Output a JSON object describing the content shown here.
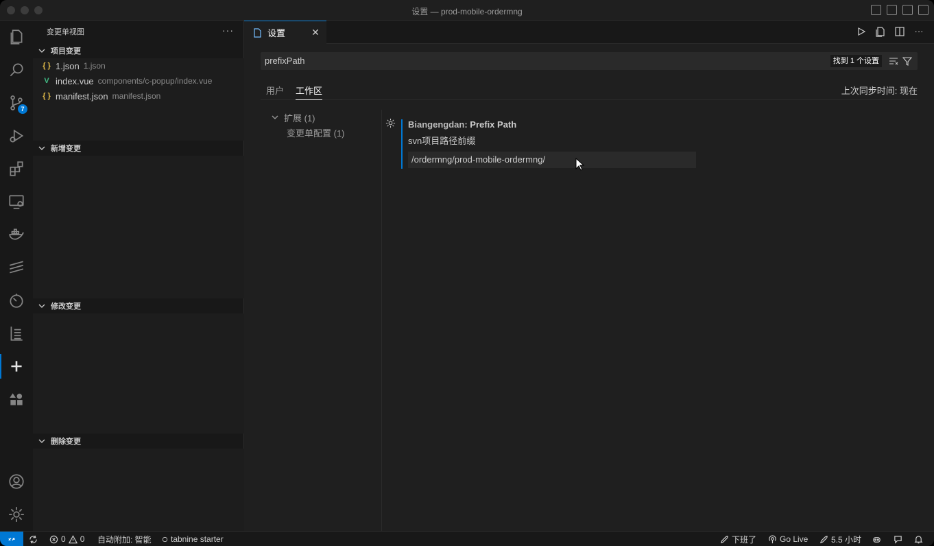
{
  "window": {
    "title": "设置 — prod-mobile-ordermng"
  },
  "activity_bar": {
    "source_control_badge": "7",
    "items": [
      "explorer-icon",
      "search-icon",
      "source-control-icon",
      "run-debug-icon",
      "extensions-icon",
      "remote-explorer-icon",
      "docker-icon",
      "svn-icon",
      "timeline-icon",
      "test-icon",
      "changelist-icon",
      "app-icon",
      "accounts-icon",
      "manage-icon"
    ]
  },
  "sidebar": {
    "title": "变更单视图",
    "more": "···",
    "sections": [
      {
        "label": "项目变更",
        "files": [
          {
            "icon": "{ }",
            "name": "1.json",
            "desc": "1.json"
          },
          {
            "icon": "V",
            "name": "index.vue",
            "desc": "components/c-popup/index.vue"
          },
          {
            "icon": "{ }",
            "name": "manifest.json",
            "desc": "manifest.json"
          }
        ]
      },
      {
        "label": "新增变更",
        "files": []
      },
      {
        "label": "修改变更",
        "files": []
      },
      {
        "label": "删除变更",
        "files": []
      }
    ]
  },
  "editor": {
    "tab": {
      "label": "设置",
      "close": "✕"
    },
    "search": {
      "value": "prefixPath",
      "found": "找到 1 个设置"
    },
    "scope_tabs": [
      {
        "label": "用户"
      },
      {
        "label": "工作区",
        "active": true
      }
    ],
    "sync_status": "上次同步时间: 现在",
    "toc": [
      {
        "label": "扩展 (1)"
      },
      {
        "label": "变更单配置 (1)"
      }
    ],
    "setting": {
      "category": "Biangengdan: ",
      "name": "Prefix Path",
      "description": "svn项目路径前缀",
      "value": "/ordermng/prod-mobile-ordermng/"
    }
  },
  "status_bar": {
    "errors": "0",
    "warnings": "0",
    "auto_attach": "自动附加: 智能",
    "tabnine": "tabnine starter",
    "off_work": "下班了",
    "go_live": "Go Live",
    "time": "5.5 小时"
  },
  "colors": {
    "accent": "#0078d4",
    "background": "#1f1f1f",
    "sidebar": "#181818"
  }
}
